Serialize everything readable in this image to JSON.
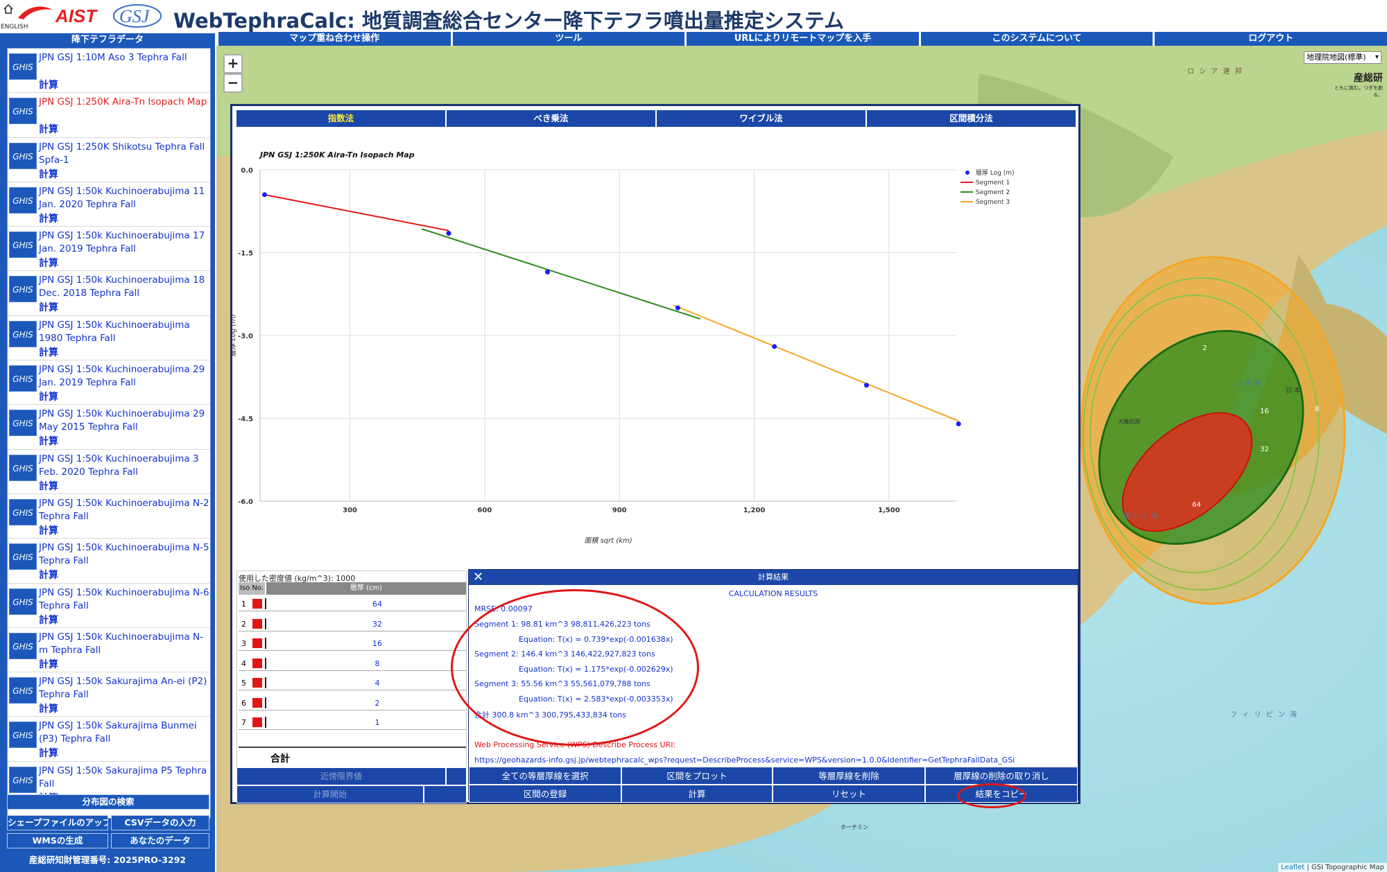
{
  "header": {
    "english_label": "ENGLISH",
    "aist_logo": "AIST",
    "gsj_logo": "GSJ",
    "title": "WebTephraCalc: 地質調査総合センター降下テフラ噴出量推定システム"
  },
  "sidebar": {
    "heading": "降下テフラデータ",
    "calc_label": "計算",
    "items": [
      {
        "name": "JPN GSJ 1:10M Aso 3 Tephra Fall",
        "selected": false
      },
      {
        "name": "JPN GSJ 1:250K Aira-Tn Isopach Map",
        "selected": true
      },
      {
        "name": "JPN GSJ 1:250K Shikotsu Tephra Fall Spfa-1",
        "selected": false
      },
      {
        "name": "JPN GSJ 1:50k Kuchinoerabujima 11 Jan. 2020 Tephra Fall",
        "selected": false
      },
      {
        "name": "JPN GSJ 1:50k Kuchinoerabujima 17 Jan. 2019 Tephra Fall",
        "selected": false
      },
      {
        "name": "JPN GSJ 1:50k Kuchinoerabujima 18 Dec. 2018 Tephra Fall",
        "selected": false
      },
      {
        "name": "JPN GSJ 1:50k Kuchinoerabujima 1980 Tephra Fall",
        "selected": false
      },
      {
        "name": "JPN GSJ 1:50k Kuchinoerabujima 29 Jan. 2019 Tephra Fall",
        "selected": false
      },
      {
        "name": "JPN GSJ 1:50k Kuchinoerabujima 29 May 2015 Tephra Fall",
        "selected": false
      },
      {
        "name": "JPN GSJ 1:50k Kuchinoerabujima 3 Feb. 2020 Tephra Fall",
        "selected": false
      },
      {
        "name": "JPN GSJ 1:50k Kuchinoerabujima N-2 Tephra Fall",
        "selected": false
      },
      {
        "name": "JPN GSJ 1:50k Kuchinoerabujima N-5 Tephra Fall",
        "selected": false
      },
      {
        "name": "JPN GSJ 1:50k Kuchinoerabujima N-6 Tephra Fall",
        "selected": false
      },
      {
        "name": "JPN GSJ 1:50k Kuchinoerabujima N-m Tephra Fall",
        "selected": false
      },
      {
        "name": "JPN GSJ 1:50k Sakurajima An-ei (P2) Tephra Fall",
        "selected": false
      },
      {
        "name": "JPN GSJ 1:50k Sakurajima Bunmei (P3) Tephra Fall",
        "selected": false
      },
      {
        "name": "JPN GSJ 1:50k Sakurajima P5 Tephra Fall",
        "selected": false
      }
    ],
    "search_button": "分布図の検索",
    "shapefile_button": "シェープファイルのアップ",
    "csv_button": "CSVデータの入力",
    "wms_button": "WMSの生成",
    "your_data_button": "あなたのデータ",
    "license": "産総研知財管理番号: 2025PRO-3292"
  },
  "topmenu": [
    "マップ重ね合わせ操作",
    "ツール",
    "URLによりリモートマップを入手",
    "このシステムについて",
    "ログアウト"
  ],
  "map": {
    "zoom_in": "+",
    "zoom_out": "−",
    "basemap_select": "地理院地図(標準)",
    "sansoken_logo": "産総研",
    "sansoken_tagline": "ともに挑む。つぎを創る。",
    "attribution_leaflet": "Leaflet",
    "attribution_rest": " | GSI Topographic Map",
    "isopach_labels": [
      "2",
      "8",
      "16",
      "32",
      "64"
    ],
    "place_labels": [
      "ロ シ ア 連 邦",
      "東 シ ナ 海",
      "日 本 海",
      "フ ィ リ ピ ン 海",
      "ホーチミン",
      "大韓民国",
      "日 本"
    ]
  },
  "panel": {
    "tabs": [
      {
        "label": "指数法",
        "active": true
      },
      {
        "label": "べき乗法",
        "active": false
      },
      {
        "label": "ワイブル法",
        "active": false
      },
      {
        "label": "区間積分法",
        "active": false
      }
    ],
    "density_label": "使用した密度値 (kg/m^3): 1000",
    "table_headers": [
      "Iso No.",
      "層厚 (cm)"
    ],
    "table_rows": [
      {
        "no": "1",
        "thickness": "64"
      },
      {
        "no": "2",
        "thickness": "32"
      },
      {
        "no": "3",
        "thickness": "16"
      },
      {
        "no": "4",
        "thickness": "8"
      },
      {
        "no": "5",
        "thickness": "4"
      },
      {
        "no": "6",
        "thickness": "2"
      },
      {
        "no": "7",
        "thickness": "1"
      }
    ],
    "total_label": "合計",
    "near_limit_button": "近傍限界値",
    "start_calc_button": "計算開始"
  },
  "result": {
    "title": "計算結果",
    "subtitle": "CALCULATION RESULTS",
    "mrse": "MRSE: 0.00097",
    "segments": [
      {
        "line": "Segment 1:  98.81 km^3    98,811,426,223 tons",
        "equation": "Equation: T(x) = 0.739*exp(-0.001638x)"
      },
      {
        "line": "Segment 2:  146.4 km^3    146,422,927,823 tons",
        "equation": "Equation: T(x) = 1.175*exp(-0.002629x)"
      },
      {
        "line": "Segment 3:  55.56 km^3    55,561,079,788 tons",
        "equation": "Equation: T(x) = 2.583*exp(-0.003353x)"
      }
    ],
    "total": "合計  300.8 km^3    300,795,433,834 tons",
    "wps_label": "Web Processing Service (WPS) Describe Process URI:",
    "wps_url": "https://geohazards-info.gsj.jp/webtephracalc_wps?request=DescribeProcess&service=WPS&version=1.0.0&Identifier=GetTephraFallData_GSi",
    "buttons_row1": [
      "全ての等層厚線を選択",
      "区間をプロット",
      "等層厚線を削除",
      "層厚線の削除の取り消し"
    ],
    "buttons_row2": [
      "区間の登録",
      "計算",
      "リセット",
      "結果をコピー"
    ]
  },
  "chart_data": {
    "type": "line",
    "title": "JPN GSJ 1:250K Aira-Tn Isopach Map",
    "xlabel": "面積 sqrt (km)",
    "ylabel": "層厚 Log (m)",
    "xlim": [
      100,
      1650
    ],
    "ylim": [
      -6.0,
      0.0
    ],
    "xticks": [
      "300",
      "600",
      "900",
      "1,200",
      "1,500"
    ],
    "yticks": [
      "0.0",
      "-1.5",
      "-3.0",
      "-4.5",
      "-6.0"
    ],
    "legend_position": "top-right",
    "points_name": "層厚 Log (m)",
    "points": [
      [
        110,
        -0.45
      ],
      [
        520,
        -1.15
      ],
      [
        740,
        -1.85
      ],
      [
        1030,
        -2.5
      ],
      [
        1245,
        -3.2
      ],
      [
        1450,
        -3.9
      ],
      [
        1655,
        -4.6
      ]
    ],
    "series": [
      {
        "name": "Segment 1",
        "color": "#e01616",
        "x": [
          110,
          520
        ],
        "y": [
          -0.45,
          -1.1
        ]
      },
      {
        "name": "Segment 2",
        "color": "#2a8a1a",
        "x": [
          460,
          1080
        ],
        "y": [
          -1.07,
          -2.7
        ]
      },
      {
        "name": "Segment 3",
        "color": "#f5a623",
        "x": [
          1020,
          1655
        ],
        "y": [
          -2.45,
          -4.55
        ]
      }
    ]
  },
  "colors": {
    "brand_blue": "#1b58b9",
    "dark_blue": "#1b47a8",
    "link_blue": "#1133cc",
    "selected_red": "#e62020",
    "annotation_red": "#e01616"
  }
}
